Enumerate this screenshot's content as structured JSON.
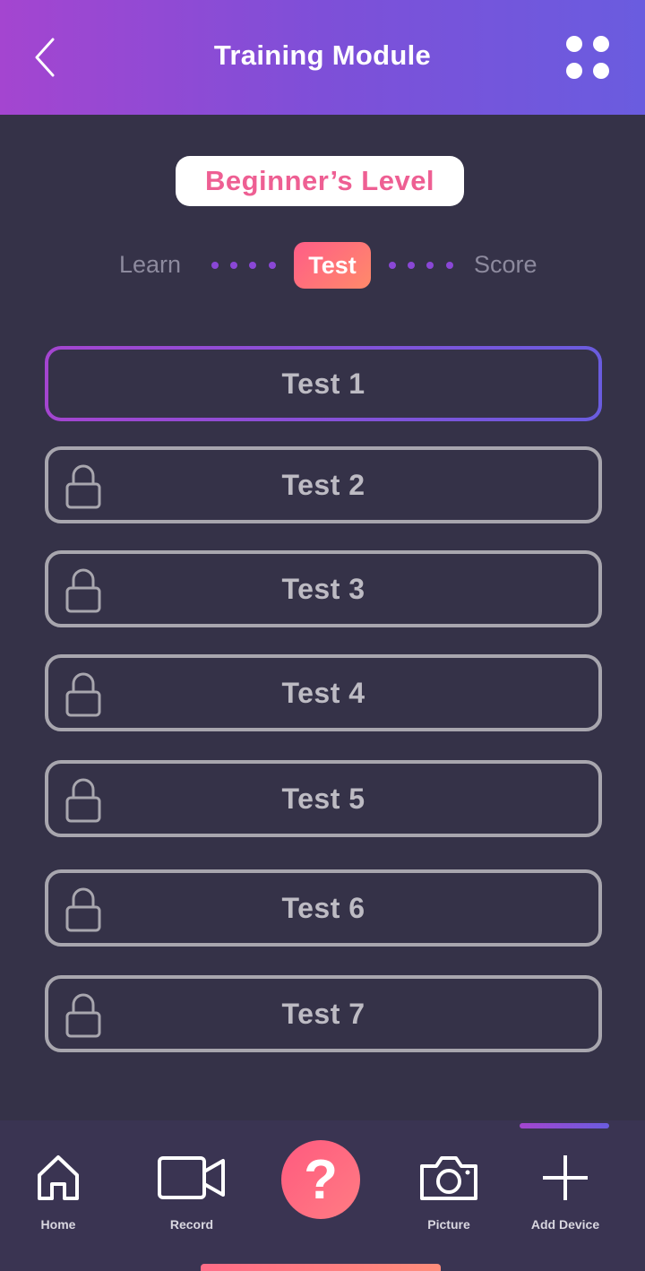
{
  "header": {
    "title": "Training Module",
    "background_gradient": [
      "#a445d0",
      "#6a5cdf"
    ]
  },
  "level": {
    "label": "Beginner’s Level"
  },
  "steps": {
    "items": [
      {
        "label": "Learn",
        "active": false
      },
      {
        "label": "Test",
        "active": true
      },
      {
        "label": "Score",
        "active": false
      }
    ]
  },
  "tests": [
    {
      "label": "Test 1",
      "locked": false,
      "active": true
    },
    {
      "label": "Test 2",
      "locked": true,
      "active": false
    },
    {
      "label": "Test 3",
      "locked": true,
      "active": false
    },
    {
      "label": "Test 4",
      "locked": true,
      "active": false
    },
    {
      "label": "Test 5",
      "locked": true,
      "active": false
    },
    {
      "label": "Test 6",
      "locked": true,
      "active": false
    },
    {
      "label": "Test 7",
      "locked": true,
      "active": false
    }
  ],
  "tab_bar": {
    "items": [
      {
        "label": "Home",
        "icon": "home-icon"
      },
      {
        "label": "Record",
        "icon": "video-camera-icon"
      },
      {
        "label": "",
        "icon": "question-mark-icon",
        "glyph": "?"
      },
      {
        "label": "Picture",
        "icon": "camera-icon"
      },
      {
        "label": "Add Device",
        "icon": "plus-icon",
        "selected": true
      }
    ]
  },
  "colors": {
    "background": "#353248",
    "accent_pink": "#ee5f93",
    "accent_orange": "#ff8a6a",
    "accent_purple": "#8a47d6",
    "locked_border": "#a8a6ae"
  }
}
